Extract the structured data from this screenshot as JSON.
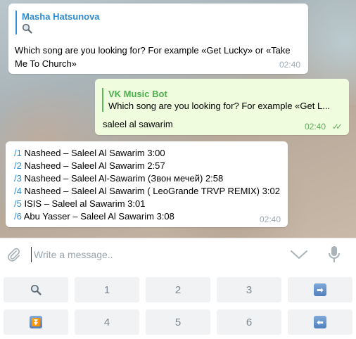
{
  "messages": {
    "first": {
      "reply_author": "Masha Hatsunova",
      "reply_icon": "magnifier",
      "text": "Which song are you looking for? For example «Get Lucky» or «Take Me To Church»",
      "time": "02:40"
    },
    "second": {
      "reply_author": "VK Music Bot",
      "reply_text": "Which song are you looking for? For example «Get L...",
      "text": "saleel al sawarim",
      "time": "02:40"
    },
    "results": {
      "items": [
        {
          "cmd": "/1",
          "text": " Nasheed – Saleel Al Sawarim 3:00"
        },
        {
          "cmd": "/2",
          "text": " Nasheed – Saleel Al Sawarim 2:57"
        },
        {
          "cmd": "/3",
          "text": " Nasheed – Saleel Al-Sawarim (Звон мечей) 2:58"
        },
        {
          "cmd": "/4",
          "text": " Nasheed – Saleel Al Sawarim ( LeoGrande TRVP REMIX) 3:02"
        },
        {
          "cmd": "/5",
          "text": " ISIS – Saleel al Sawarim 3:01"
        },
        {
          "cmd": "/6",
          "text": " Abu Yasser – Saleel Al Sawarim 3:08"
        }
      ],
      "time": "02:40"
    }
  },
  "composer": {
    "placeholder": "Write a message.."
  },
  "keyboard": {
    "row1": [
      {
        "type": "icon",
        "icon": "magnifier"
      },
      {
        "type": "text",
        "label": "1"
      },
      {
        "type": "text",
        "label": "2"
      },
      {
        "type": "text",
        "label": "3"
      },
      {
        "type": "icon",
        "icon": "arrow-right"
      }
    ],
    "row2": [
      {
        "type": "icon",
        "icon": "arrow-down"
      },
      {
        "type": "text",
        "label": "4"
      },
      {
        "type": "text",
        "label": "5"
      },
      {
        "type": "text",
        "label": "6"
      },
      {
        "type": "icon",
        "icon": "arrow-left"
      }
    ]
  },
  "colors": {
    "link_blue": "#2f8bd0",
    "outgoing_bubble": "#effdde",
    "outgoing_accent": "#5bb95a"
  }
}
